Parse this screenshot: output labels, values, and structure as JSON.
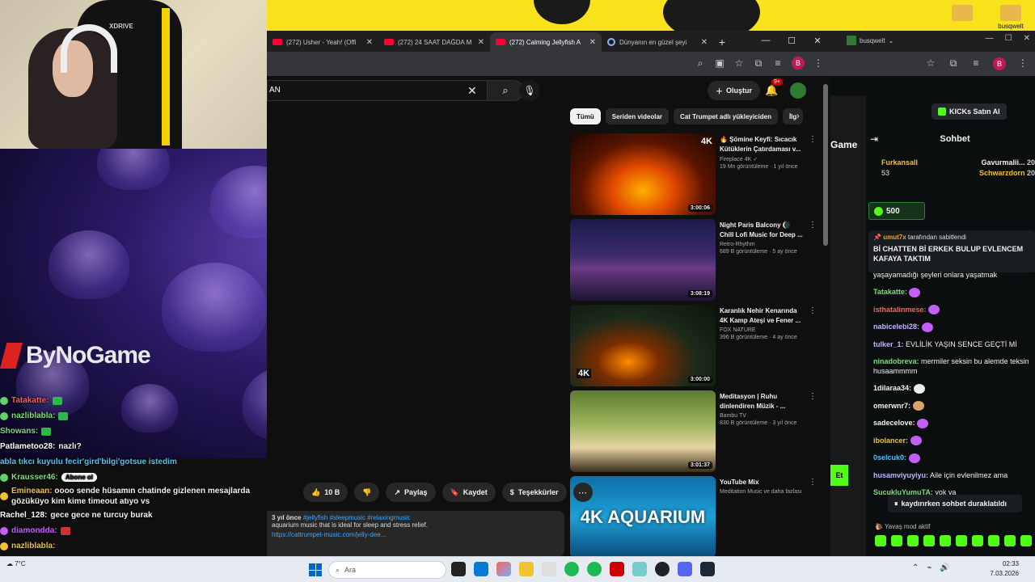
{
  "desktop": {
    "icons": [
      {
        "label": ""
      },
      {
        "label": "busqwelt Yayın Ayarları"
      }
    ]
  },
  "webcam": {
    "brand": "XDRIVE"
  },
  "chrome_left": {
    "tabs": [
      {
        "title": "(272) Usher - Yeah! (Offi",
        "icon": "youtube-icon"
      },
      {
        "title": "(272) 24 SAAT DAĞDA M",
        "icon": "youtube-icon"
      },
      {
        "title": "(272) Calming Jellyfish A",
        "icon": "youtube-icon",
        "active": true
      },
      {
        "title": "Dünyanın en güzel şeyi",
        "icon": "globe-icon"
      }
    ],
    "profile_initial": "B"
  },
  "youtube": {
    "search_value": "AN",
    "create_label": "Oluştur",
    "notif_count": "9+",
    "actions": {
      "likes": "10 B",
      "share": "Paylaş",
      "save": "Kaydet",
      "thanks": "Teşekkürler"
    },
    "description": {
      "meta": "3 yıl önce",
      "tags": "#jellyfish #sleepmusic #relaxingmusic",
      "text": "aquarium music that is ideal for sleep and stress relief.",
      "link": "https://cattrumpet-music.com/jelly-dee..."
    },
    "chips": [
      "Tümü",
      "Seriden videolar",
      "Cat Trumpet adlı yükleyiciden",
      "İlg"
    ],
    "recommendations": [
      {
        "title": "🔥 Şömine Keyfi: Sıcacık Kütüklerin Çatırdaması v...",
        "channel": "Fireplace 4K ✓",
        "views": "19 Mn görüntüleme · 1 yıl önce",
        "duration": "3:00:06",
        "badge": "4K",
        "thumb": "th-fire"
      },
      {
        "title": "Night Paris Balcony 🌘 Chill Lofi Music for Deep ...",
        "channel": "Retro-Rhythm",
        "views": "689 B görüntüleme · 5 ay önce",
        "duration": "3:08:19",
        "badge": "",
        "thumb": "th-paris"
      },
      {
        "title": "Karanlık Nehir Kenarında 4K Kamp Ateşi ve Fener ...",
        "channel": "FOX NATURE",
        "views": "396 B görüntüleme · 4 ay önce",
        "duration": "3:00:00",
        "badge": "4K",
        "thumb": "th-forest"
      },
      {
        "title": "Meditasyon | Ruhu dinlendiren Müzik - ...",
        "channel": "Bambu TV",
        "views": "830 B görüntüleme · 3 yıl önce",
        "duration": "3:01:37",
        "badge": "",
        "thumb": "th-spa"
      },
      {
        "title": "YouTube Mix",
        "channel": "Meditation Music ve daha fazlası",
        "views": "",
        "duration": "",
        "badge": "",
        "thumb": "th-aqua",
        "overlay_text": "4K AQUARIUM"
      }
    ]
  },
  "stream_overlay": {
    "logo_text": "ByNoGame",
    "chat": [
      {
        "user": "Tatakatte:",
        "text": "",
        "color": "#ff5d5d"
      },
      {
        "user": "nazliblabla:",
        "text": "",
        "color": "#7fdc7f"
      },
      {
        "user": "Showans:",
        "text": "",
        "color": "#7fdc7f"
      },
      {
        "user": "Patlametoo28:",
        "text": "nazlı?",
        "color": "#ffffff"
      },
      {
        "user": "",
        "text": "abla tıkcı kuyulu fecir'gird'bilgi'gotsue istedim",
        "color": "#4fc3f7"
      },
      {
        "user": "Krausser46:",
        "text": "",
        "color": "#7fdc7f"
      },
      {
        "user": "Emineaan:",
        "text": "oooo sende hüsamın chatinde gizlenen mesajlarda gözüküyo kim kime timeout atıyo vs",
        "color": "#f1c232"
      },
      {
        "user": "Rachel_128:",
        "text": "gece gece ne turcuy burak",
        "color": "#ffffff"
      },
      {
        "user": "diamondda:",
        "text": "",
        "color": "#c45ff5"
      },
      {
        "user": "nazliblabla:",
        "text": "",
        "color": "#f1c232"
      }
    ],
    "subscribe_label": "Abone ol"
  },
  "kick": {
    "window_user": "busqwelt",
    "buy_label": "KICKs Satın Al",
    "chat_title": "Sohbet",
    "gifters": [
      {
        "name": "Furkansall",
        "count": "53"
      },
      {
        "name": "Gavurmalii...",
        "count": "20"
      },
      {
        "name": "Schwarzdorn",
        "count": "20"
      }
    ],
    "gift_amount": "500",
    "pinned": {
      "by": "umut7x",
      "by_suffix": "tarafından sabitlendi",
      "text": "Bİ CHATTEN Bİ ERKEK BULUP EVLENCEM KAFAYA TAKTIM"
    },
    "messages": [
      {
        "user": "",
        "text": "yaşayamadığı şeyleri onlara yaşatmak",
        "color": "#ffffff"
      },
      {
        "user": "Tatakatte:",
        "text": "",
        "color": "#7fdc7f"
      },
      {
        "user": "isthatalinmese:",
        "text": "",
        "color": "#ff5d5d"
      },
      {
        "user": "nabicelebi28:",
        "text": "",
        "color": "#c5b3ff"
      },
      {
        "user": "tulker_1:",
        "text": "EVLİLİK YAŞIN SENCE GEÇTİ Mİ",
        "color": "#c5b3ff"
      },
      {
        "user": "ninadobreva:",
        "text": "mermiler seksin bu alemde teksin husaammmm",
        "color": "#7fdc7f"
      },
      {
        "user": "1dilaraa34:",
        "text": "",
        "color": "#ffffff"
      },
      {
        "user": "omerwnr7:",
        "text": "",
        "color": "#ffffff"
      },
      {
        "user": "sadecelove:",
        "text": "",
        "color": "#ffffff"
      },
      {
        "user": "ibolancer:",
        "text": "",
        "color": "#f1c232"
      },
      {
        "user": "0selcuk0:",
        "text": "",
        "color": "#4fc3f7"
      },
      {
        "user": "husamviyuyiyu:",
        "text": "Aile için evlenilmez ama",
        "color": "#c5b3ff"
      },
      {
        "user": "SucukluYumuTA:",
        "text": "yok ya",
        "color": "#7fdc7f"
      }
    ],
    "paused_label": "kaydırırken sohbet duraklatıldı",
    "slow_mode": "Yavaş mod aktif"
  },
  "taskbar": {
    "weather": "7°C",
    "search_placeholder": "Ara",
    "time": "02:33",
    "date": "7.03.2026"
  }
}
